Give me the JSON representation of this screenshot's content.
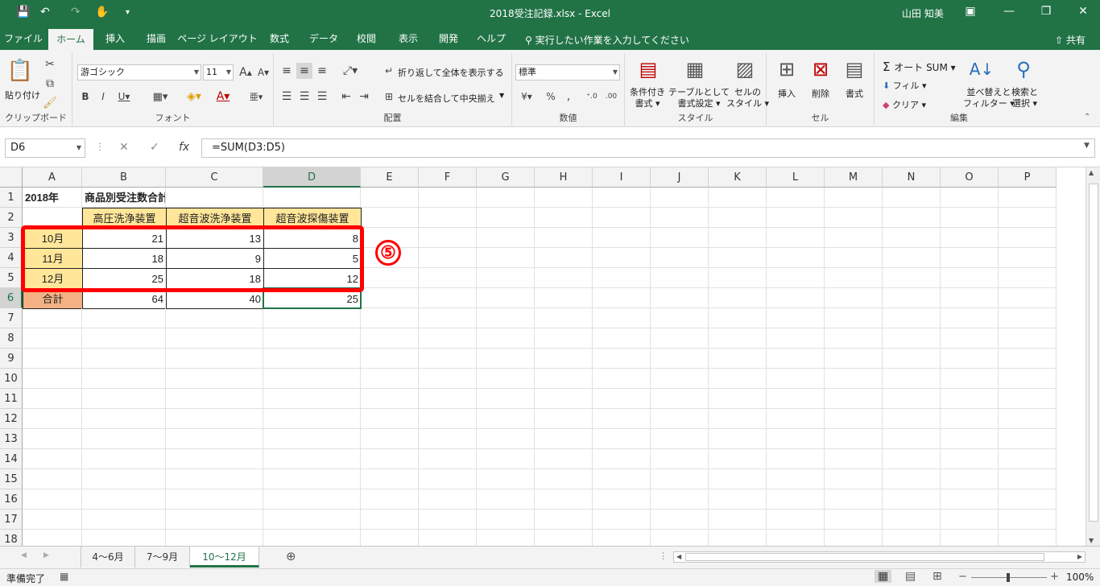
{
  "window": {
    "title": "2018受注記録.xlsx  -  Excel",
    "user": "山田 知美"
  },
  "menu": {
    "tabs": [
      "ファイル",
      "ホーム",
      "挿入",
      "描画",
      "ページ レイアウト",
      "数式",
      "データ",
      "校閲",
      "表示",
      "開発",
      "ヘルプ"
    ],
    "active": "ホーム",
    "tellme": "実行したい作業を入力してください",
    "share": "共有"
  },
  "ribbon": {
    "clipboard": {
      "label": "クリップボード",
      "paste": "貼り付け"
    },
    "font": {
      "label": "フォント",
      "name": "游ゴシック",
      "size": "11"
    },
    "alignment": {
      "label": "配置",
      "wrap": "折り返して全体を表示する",
      "merge": "セルを結合して中央揃え"
    },
    "number": {
      "label": "数値",
      "format": "標準"
    },
    "styles": {
      "label": "スタイル",
      "cond": [
        "条件付き",
        "書式"
      ],
      "table": [
        "テーブルとして",
        "書式設定"
      ],
      "cell": [
        "セルの",
        "スタイル"
      ]
    },
    "cells": {
      "label": "セル",
      "insert": "挿入",
      "delete": "削除",
      "format": "書式"
    },
    "editing": {
      "label": "編集",
      "autosum": "オート SUM",
      "fill": "フィル",
      "clear": "クリア",
      "sort": [
        "並べ替えと",
        "フィルター"
      ],
      "find": [
        "検索と",
        "選択"
      ]
    }
  },
  "formula_bar": {
    "namebox": "D6",
    "formula": "=SUM(D3:D5)"
  },
  "columns": [
    "A",
    "B",
    "C",
    "D",
    "E",
    "F",
    "G",
    "H",
    "I",
    "J",
    "K",
    "L",
    "M",
    "N",
    "O",
    "P"
  ],
  "rows": [
    "1",
    "2",
    "3",
    "4",
    "5",
    "6",
    "7",
    "8",
    "9",
    "10",
    "11",
    "12",
    "13",
    "14",
    "15",
    "16",
    "17",
    "18"
  ],
  "cells": {
    "A1": "2018年",
    "B1": "商品別受注数合計",
    "B2": "高圧洗浄装置",
    "C2": "超音波洗浄装置",
    "D2": "超音波探傷装置",
    "A3": "10月",
    "B3": "21",
    "C3": "13",
    "D3": "8",
    "A4": "11月",
    "B4": "18",
    "C4": "9",
    "D4": "5",
    "A5": "12月",
    "B5": "25",
    "C5": "18",
    "D5": "12",
    "A6": "合計",
    "B6": "64",
    "C6": "40",
    "D6": "25"
  },
  "callout": "⑤",
  "colors": {
    "header_fill": "#ffe699",
    "total_fill": "#f4b183",
    "accent": "#217346",
    "highlight": "#ff0000"
  },
  "sheets": [
    "4～6月",
    "7～9月",
    "10～12月"
  ],
  "active_sheet": "10～12月",
  "status": {
    "ready": "準備完了",
    "zoom": "100%"
  }
}
